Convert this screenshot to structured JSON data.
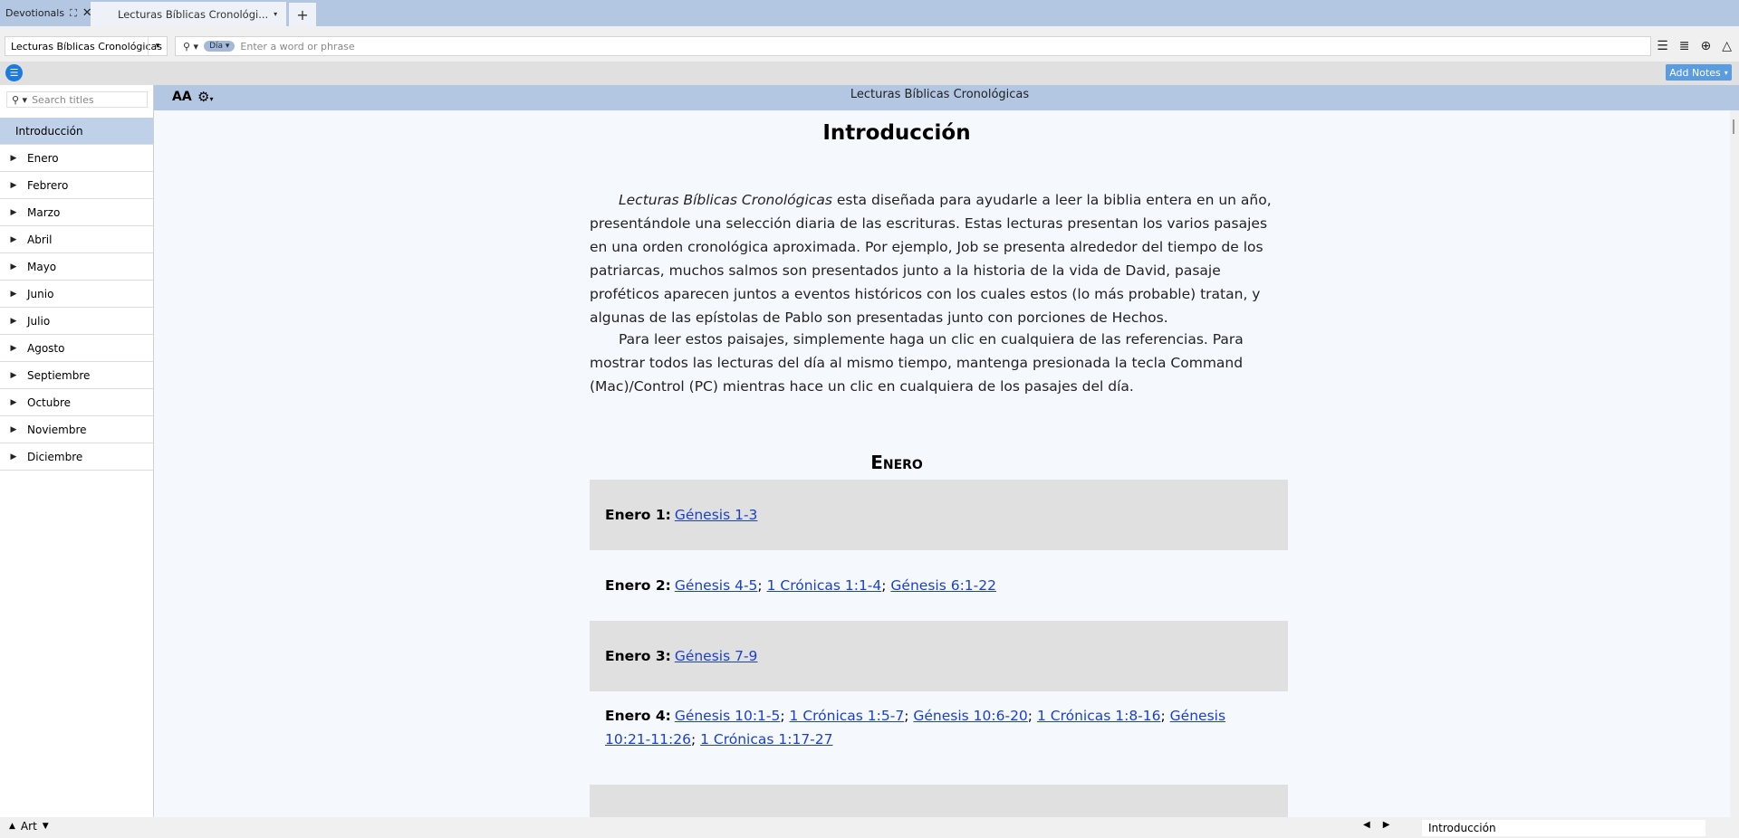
{
  "tabs": {
    "devotionals_label": "Devotionals",
    "active_label": "Lecturas Bíblicas Cronológi..."
  },
  "toolbar": {
    "resource_name": "Lecturas Bíblicas Cronológicas",
    "search_scope": "Día",
    "search_placeholder": "Enter a word or phrase"
  },
  "subbar": {
    "add_notes_label": "Add Notes"
  },
  "sidebar": {
    "search_placeholder": "Search titles",
    "items": [
      {
        "label": "Introducción"
      },
      {
        "label": "Enero"
      },
      {
        "label": "Febrero"
      },
      {
        "label": "Marzo"
      },
      {
        "label": "Abril"
      },
      {
        "label": "Mayo"
      },
      {
        "label": "Junio"
      },
      {
        "label": "Julio"
      },
      {
        "label": "Agosto"
      },
      {
        "label": "Septiembre"
      },
      {
        "label": "Octubre"
      },
      {
        "label": "Noviembre"
      },
      {
        "label": "Diciembre"
      }
    ]
  },
  "content": {
    "header_title": "Lecturas Bíblicas Cronológicas",
    "font_size_label": "AA",
    "doc_title": "Introducción",
    "p1_italic": "Lecturas Bíblicas Cronológicas",
    "p1_rest": " esta diseñada para ayudarle a leer la biblia entera en un año, presentándole una selección diaria de las escrituras. Estas lecturas presentan los varios pasajes en una orden cronológica aproximada. Por ejemplo, Job se presenta alrededor del tiempo de los patriarcas, muchos salmos son presentados junto a la historia de la vida de David, pasaje proféticos aparecen juntos a eventos históricos con los cuales estos (lo más probable) tratan, y algunas de las epístolas de Pablo son presentadas junto con porciones de Hechos.",
    "p2": "Para leer estos paisajes, simplemente haga un clic en cualquiera de las referencias. Para mostrar todos las lecturas del día al mismo tiempo, mantenga presionada la tecla Command (Mac)/Control (PC) mientras hace un clic en cualquiera de los pasajes del día.",
    "month_heading": "Enero",
    "readings": [
      {
        "day": "Enero 1:",
        "refs": [
          "Génesis 1-3"
        ]
      },
      {
        "day": "Enero 2:",
        "refs": [
          "Génesis 4-5",
          "1 Crónicas 1:1-4",
          "Génesis 6:1-22"
        ]
      },
      {
        "day": "Enero 3:",
        "refs": [
          "Génesis 7-9"
        ]
      },
      {
        "day": "Enero 4:",
        "refs": [
          "Génesis 10:1-5",
          "1 Crónicas 1:5-7",
          "Génesis 10:6-20",
          "1 Crónicas 1:8-16",
          "Génesis 10:21-11:26",
          "1 Crónicas 1:17-27"
        ]
      }
    ]
  },
  "statusbar": {
    "art_label": "Art",
    "current_title": "Introducción"
  }
}
